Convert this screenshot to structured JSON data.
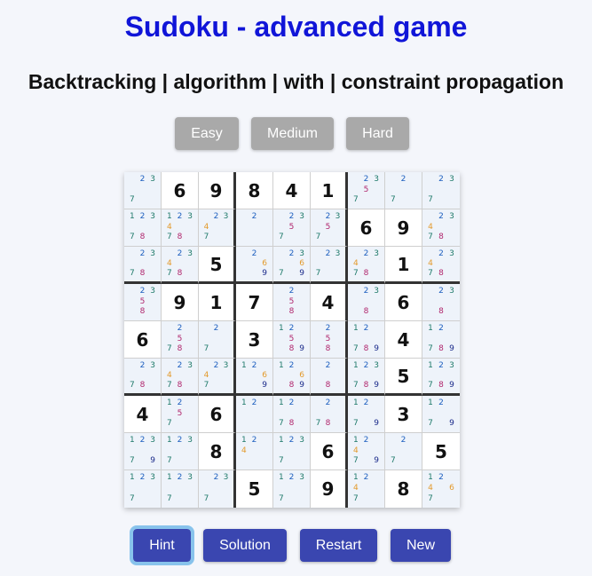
{
  "title": "Sudoku - advanced game",
  "subtitle": "Backtracking | algorithm | with | constraint propagation",
  "difficulty": {
    "easy": "Easy",
    "medium": "Medium",
    "hard": "Hard"
  },
  "actions": {
    "hint": "Hint",
    "solution": "Solution",
    "restart": "Restart",
    "new": "New"
  },
  "colors": {
    "title": "#1015d8",
    "difficulty_button": "#a9a9a9",
    "action_button": "#3a46b0",
    "focus_ring": "#88c3ec",
    "cell_light": "#eef3fa"
  },
  "board": [
    [
      0,
      6,
      9,
      8,
      4,
      1,
      0,
      0,
      0
    ],
    [
      0,
      0,
      0,
      0,
      0,
      0,
      6,
      9,
      0
    ],
    [
      0,
      0,
      5,
      0,
      0,
      0,
      0,
      1,
      0
    ],
    [
      0,
      9,
      1,
      7,
      0,
      4,
      0,
      6,
      0
    ],
    [
      6,
      0,
      0,
      3,
      0,
      0,
      0,
      4,
      0
    ],
    [
      0,
      0,
      0,
      0,
      0,
      0,
      0,
      5,
      0
    ],
    [
      4,
      0,
      6,
      0,
      0,
      0,
      0,
      3,
      0
    ],
    [
      0,
      0,
      8,
      0,
      0,
      6,
      0,
      0,
      5
    ],
    [
      0,
      0,
      0,
      5,
      0,
      9,
      0,
      8,
      0
    ]
  ],
  "candidates": [
    [
      [
        2,
        3,
        7
      ],
      [],
      [],
      [],
      [],
      [],
      [
        2,
        3,
        5,
        7
      ],
      [
        2,
        7
      ],
      [
        2,
        3,
        7
      ]
    ],
    [
      [
        1,
        2,
        3,
        7,
        8
      ],
      [
        1,
        2,
        3,
        4,
        7,
        8
      ],
      [
        2,
        3,
        4,
        7
      ],
      [
        2
      ],
      [
        2,
        3,
        5,
        7
      ],
      [
        2,
        3,
        5,
        7
      ],
      [],
      [],
      [
        2,
        3,
        4,
        7,
        8
      ]
    ],
    [
      [
        2,
        3,
        7,
        8
      ],
      [
        2,
        3,
        4,
        7,
        8
      ],
      [],
      [
        2,
        6,
        9
      ],
      [
        2,
        3,
        6,
        7,
        9
      ],
      [
        2,
        3,
        7
      ],
      [
        2,
        3,
        4,
        7,
        8
      ],
      [],
      [
        2,
        3,
        4,
        7,
        8
      ]
    ],
    [
      [
        2,
        3,
        5,
        8
      ],
      [],
      [],
      [],
      [
        2,
        5,
        8
      ],
      [],
      [
        2,
        3,
        8
      ],
      [],
      [
        2,
        3,
        8
      ]
    ],
    [
      [],
      [
        2,
        5,
        7,
        8
      ],
      [
        2,
        7
      ],
      [],
      [
        1,
        2,
        5,
        8,
        9
      ],
      [
        2,
        5,
        8
      ],
      [
        1,
        2,
        7,
        8,
        9
      ],
      [],
      [
        1,
        2,
        7,
        8,
        9
      ]
    ],
    [
      [
        2,
        3,
        7,
        8
      ],
      [
        2,
        3,
        4,
        7,
        8
      ],
      [
        2,
        3,
        4,
        7
      ],
      [
        1,
        2,
        6,
        9
      ],
      [
        1,
        2,
        6,
        8,
        9
      ],
      [
        2,
        8
      ],
      [
        1,
        2,
        3,
        7,
        8,
        9
      ],
      [],
      [
        1,
        2,
        3,
        7,
        8,
        9
      ]
    ],
    [
      [],
      [
        1,
        2,
        5,
        7
      ],
      [],
      [
        1,
        2
      ],
      [
        1,
        2,
        7,
        8
      ],
      [
        2,
        7,
        8
      ],
      [
        1,
        2,
        7,
        9
      ],
      [],
      [
        1,
        2,
        7,
        9
      ]
    ],
    [
      [
        1,
        2,
        3,
        7,
        9
      ],
      [
        1,
        2,
        3,
        7
      ],
      [],
      [
        1,
        2,
        4
      ],
      [
        1,
        2,
        3,
        7
      ],
      [],
      [
        1,
        2,
        4,
        7,
        9
      ],
      [
        2,
        7
      ],
      []
    ],
    [
      [
        1,
        2,
        3,
        7
      ],
      [
        1,
        2,
        3,
        7
      ],
      [
        2,
        3,
        7
      ],
      [],
      [
        1,
        2,
        3,
        7
      ],
      [],
      [
        1,
        2,
        4,
        7
      ],
      [],
      [
        1,
        2,
        4,
        6,
        7
      ]
    ]
  ]
}
